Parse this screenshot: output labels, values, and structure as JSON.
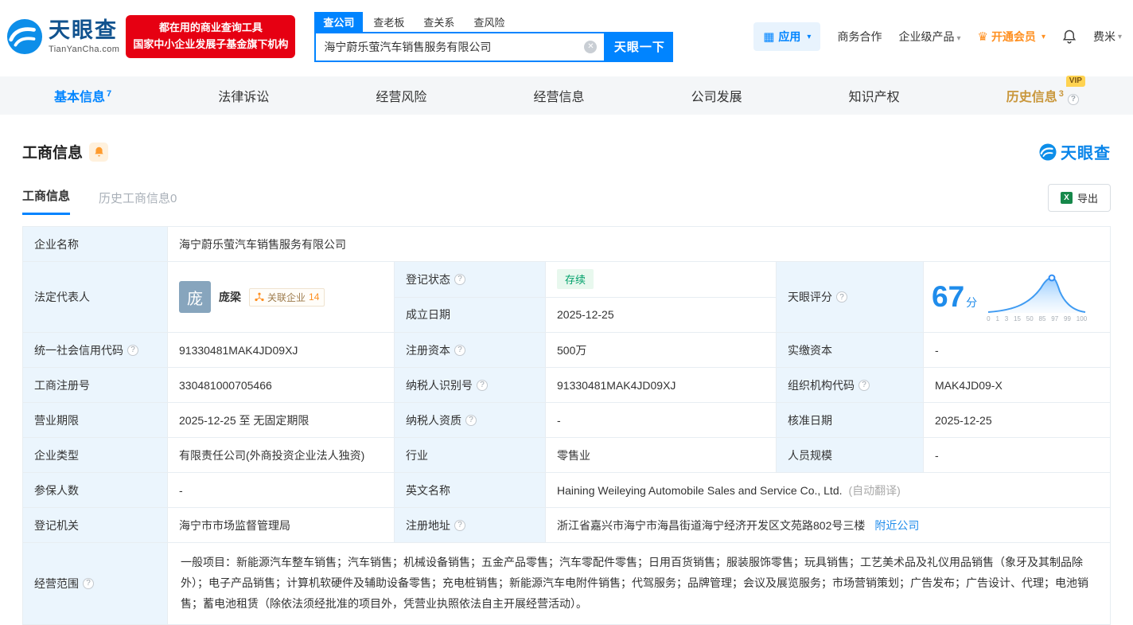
{
  "icons": {
    "caret": "▾",
    "clear": "✕",
    "grid": "▦",
    "crown": "♛",
    "help": "?",
    "excel": "X"
  },
  "header": {
    "brand": "天眼查",
    "brand_domain": "TianYanCha.com",
    "slogan_line1": "都在用的商业查询工具",
    "slogan_line2": "国家中小企业发展子基金旗下机构",
    "search_tabs": [
      {
        "label": "查公司"
      },
      {
        "label": "查老板"
      },
      {
        "label": "查关系"
      },
      {
        "label": "查风险"
      }
    ],
    "search_value": "海宁蔚乐萤汽车销售服务有限公司",
    "search_button": "天眼一下",
    "app_label": "应用",
    "link_cooperation": "商务合作",
    "link_enterprise": "企业级产品",
    "vip_label": "开通会员",
    "user_name": "费米"
  },
  "nav": {
    "tabs": [
      {
        "label": "基本信息",
        "count": "7"
      },
      {
        "label": "法律诉讼",
        "count": ""
      },
      {
        "label": "经营风险",
        "count": ""
      },
      {
        "label": "经营信息",
        "count": ""
      },
      {
        "label": "公司发展",
        "count": ""
      },
      {
        "label": "知识产权",
        "count": ""
      },
      {
        "label": "历史信息",
        "count": "3"
      }
    ],
    "vip_badge": "VIP"
  },
  "section": {
    "title": "工商信息",
    "brand": "天眼查",
    "subtab_active": "工商信息",
    "subtab_history": "历史工商信息0",
    "export_label": "导出"
  },
  "info": {
    "company_name_label": "企业名称",
    "company_name": "海宁蔚乐萤汽车销售服务有限公司",
    "legal_rep_label": "法定代表人",
    "legal_rep_avatar": "庞",
    "legal_rep_name": "庞梁",
    "related_label": "关联企业",
    "related_count": "14",
    "reg_status_label": "登记状态",
    "reg_status": "存续",
    "est_date_label": "成立日期",
    "est_date": "2025-12-25",
    "score_label": "天眼评分",
    "score_value": "67",
    "score_unit": "分",
    "score_ticks": [
      "0",
      "1",
      "3",
      "15",
      "50",
      "85",
      "97",
      "99",
      "100"
    ],
    "grid_rows": [
      {
        "cells": [
          {
            "l": "统一社会信用代码",
            "v": "91330481MAK4JD09XJ"
          },
          {
            "l": "注册资本",
            "v": "500万"
          },
          {
            "l": "实缴资本",
            "v": "-"
          }
        ]
      },
      {
        "cells": [
          {
            "l": "工商注册号",
            "v": "330481000705466"
          },
          {
            "l": "纳税人识别号",
            "v": "91330481MAK4JD09XJ"
          },
          {
            "l": "组织机构代码",
            "v": "MAK4JD09-X"
          }
        ]
      },
      {
        "cells": [
          {
            "l": "营业期限",
            "v": "2025-12-25 至 无固定期限"
          },
          {
            "l": "纳税人资质",
            "v": "-"
          },
          {
            "l": "核准日期",
            "v": "2025-12-25"
          }
        ]
      },
      {
        "cells": [
          {
            "l": "企业类型",
            "v": "有限责任公司(外商投资企业法人独资)"
          },
          {
            "l": "行业",
            "v": "零售业"
          },
          {
            "l": "人员规模",
            "v": "-"
          }
        ]
      }
    ],
    "insured": {
      "label": "参保人数",
      "value": "-"
    },
    "english": {
      "label": "英文名称",
      "value": "Haining Weileying Automobile Sales and Service Co., Ltd.",
      "note": "(自动翻译)"
    },
    "authority": {
      "label": "登记机关",
      "value": "海宁市市场监督管理局"
    },
    "address": {
      "label": "注册地址",
      "value": "浙江省嘉兴市海宁市海昌街道海宁经济开发区文苑路802号三楼",
      "link": "附近公司"
    },
    "scope": {
      "label": "经营范围",
      "value": "一般项目：新能源汽车整车销售；汽车销售；机械设备销售；五金产品零售；汽车零配件零售；日用百货销售；服装服饰零售；玩具销售；工艺美术品及礼仪用品销售（象牙及其制品除外）；电子产品销售；计算机软硬件及辅助设备零售；充电桩销售；新能源汽车电附件销售；代驾服务；品牌管理；会议及展览服务；市场营销策划；广告发布；广告设计、代理；电池销售；蓄电池租赁（除依法须经批准的项目外，凭营业执照依法自主开展经营活动）。"
    }
  }
}
